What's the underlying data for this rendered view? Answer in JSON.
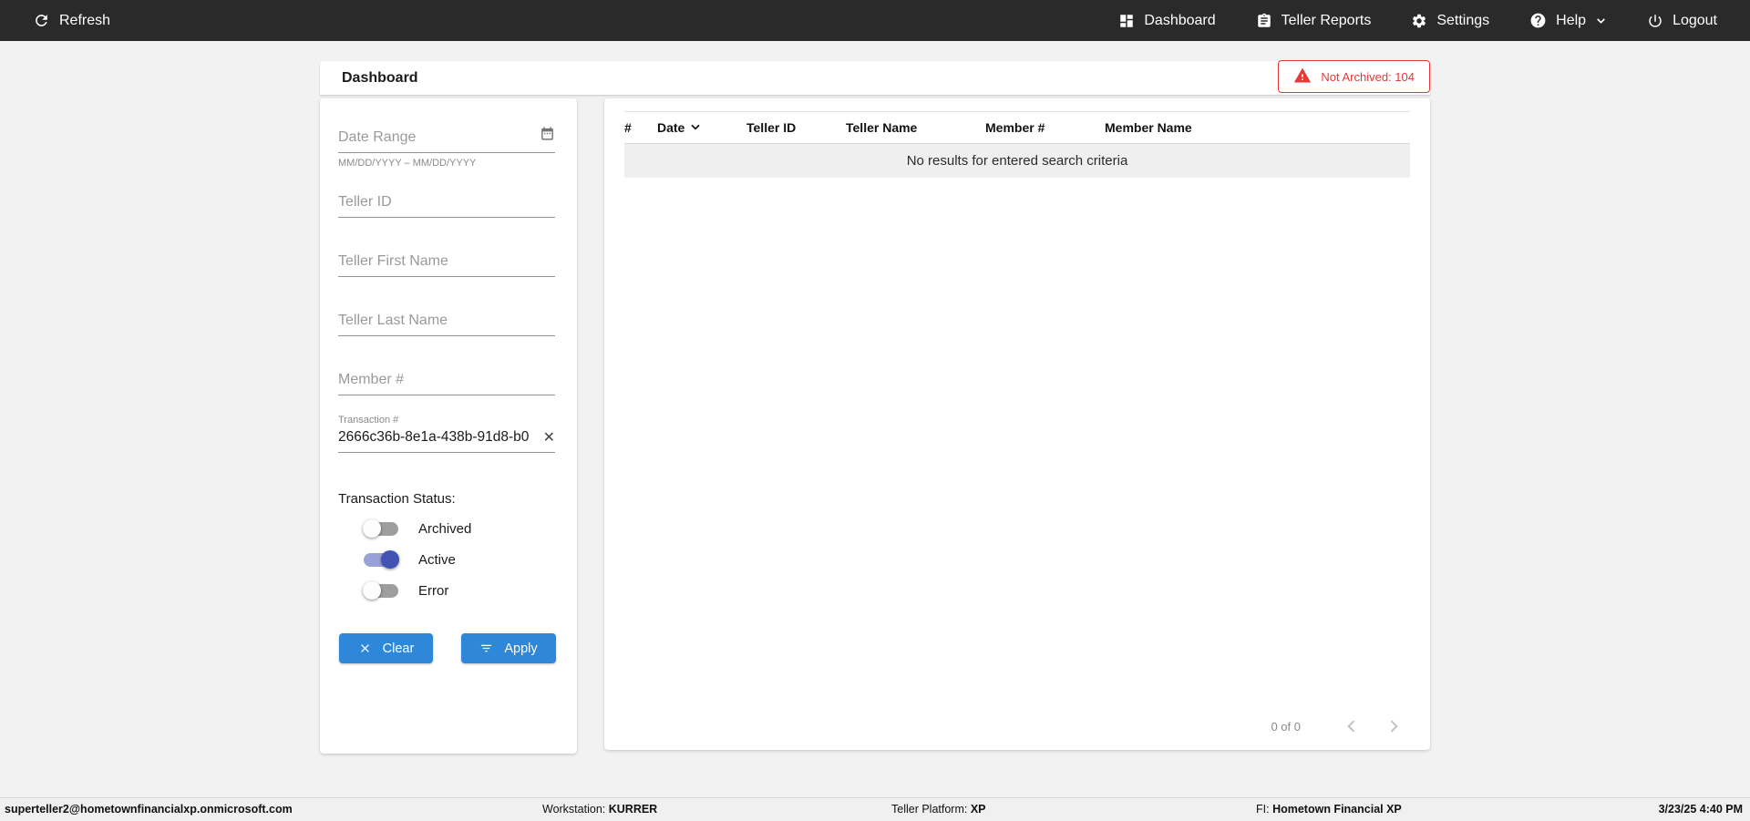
{
  "topnav": {
    "refresh_label": "Refresh",
    "dashboard_label": "Dashboard",
    "teller_reports_label": "Teller Reports",
    "settings_label": "Settings",
    "help_label": "Help",
    "logout_label": "Logout"
  },
  "header": {
    "title": "Dashboard",
    "badge": {
      "label": "Not Archived: 104",
      "icon": "warning-triangle-icon",
      "color": "#e53935"
    }
  },
  "filters": {
    "date_range": {
      "placeholder": "Date Range",
      "helper": "MM/DD/YYYY – MM/DD/YYYY",
      "icon": "calendar-icon"
    },
    "teller_id": {
      "placeholder": "Teller ID"
    },
    "teller_first_name": {
      "placeholder": "Teller First Name"
    },
    "teller_last_name": {
      "placeholder": "Teller Last Name"
    },
    "member_number": {
      "placeholder": "Member #"
    },
    "transaction_number": {
      "label": "Transaction #",
      "value": "2666c36b-8e1a-438b-91d8-b0",
      "clear_glyph": "✕"
    },
    "status": {
      "label": "Transaction Status:",
      "toggles": [
        {
          "label": "Archived",
          "on": false
        },
        {
          "label": "Active",
          "on": true
        },
        {
          "label": "Error",
          "on": false
        }
      ]
    },
    "clear_label": "Clear",
    "apply_label": "Apply"
  },
  "table": {
    "columns": [
      "#",
      "Date",
      "Teller ID",
      "Teller Name",
      "Member #",
      "Member Name"
    ],
    "sorted_column": "Date",
    "sort_direction": "desc",
    "empty_message": "No results for entered search criteria",
    "pagination": {
      "range": "0 of 0"
    }
  },
  "footer": {
    "user": "superteller2@hometownfinancialxp.onmicrosoft.com",
    "workstation_label": "Workstation:",
    "workstation_value": "KURRER",
    "platform_label": "Teller Platform:",
    "platform_value": "XP",
    "fi_label": "FI:",
    "fi_value": "Hometown Financial XP",
    "datetime": "3/23/25 4:40 PM"
  },
  "colors": {
    "topnav_bg": "#2a2a2a",
    "accent_blue": "#2e87d8",
    "alert_red": "#e53935",
    "toggle_on_thumb": "#4353b4",
    "toggle_on_track": "#98a2d8",
    "page_bg": "#f2f2f2"
  }
}
